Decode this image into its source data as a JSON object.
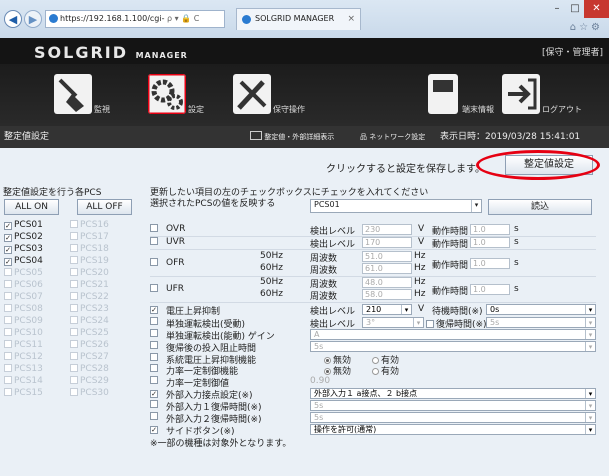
{
  "browser": {
    "url": "https://192.168.1.100/cgi-",
    "url_suffix": "ρ ▾ 🔒 C",
    "tab_title": "SOLGRID MANAGER",
    "tab_close": "×"
  },
  "header": {
    "logo": "SOLGRID",
    "logo_sub": "MANAGER",
    "right_label": "[保守・管理者]"
  },
  "icon_bar": [
    {
      "label": "監視"
    },
    {
      "label": "設定"
    },
    {
      "label": "保守操作"
    },
    {
      "label": "端末情報"
    },
    {
      "label": "ログアウト"
    }
  ],
  "subheader": {
    "title": "整定値設定",
    "link1": "整定値・外部詳細表示",
    "link2": "ネットワーク設定",
    "datetime": "表示日時：2019/03/28 15:41:01"
  },
  "main": {
    "save_hint": "クリックすると設定を保存します。",
    "save_button": "整定値設定",
    "pcs_caption": "整定値設定を行う各PCS",
    "all_on": "ALL ON",
    "all_off": "ALL OFF",
    "pcs_left": [
      {
        "label": "PCS01",
        "checked": true
      },
      {
        "label": "PCS02",
        "checked": true
      },
      {
        "label": "PCS03",
        "checked": true
      },
      {
        "label": "PCS04",
        "checked": true
      },
      {
        "label": "PCS05",
        "checked": false
      },
      {
        "label": "PCS06",
        "checked": false
      },
      {
        "label": "PCS07",
        "checked": false
      },
      {
        "label": "PCS08",
        "checked": false
      },
      {
        "label": "PCS09",
        "checked": false
      },
      {
        "label": "PCS10",
        "checked": false
      },
      {
        "label": "PCS11",
        "checked": false
      },
      {
        "label": "PCS12",
        "checked": false
      },
      {
        "label": "PCS13",
        "checked": false
      },
      {
        "label": "PCS14",
        "checked": false
      },
      {
        "label": "PCS15",
        "checked": false
      }
    ],
    "pcs_right": [
      {
        "label": "PCS16"
      },
      {
        "label": "PCS17"
      },
      {
        "label": "PCS18"
      },
      {
        "label": "PCS19"
      },
      {
        "label": "PCS20"
      },
      {
        "label": "PCS21"
      },
      {
        "label": "PCS22"
      },
      {
        "label": "PCS23"
      },
      {
        "label": "PCS24"
      },
      {
        "label": "PCS25"
      },
      {
        "label": "PCS26"
      },
      {
        "label": "PCS27"
      },
      {
        "label": "PCS28"
      },
      {
        "label": "PCS29"
      },
      {
        "label": "PCS30"
      }
    ],
    "instruction1": "更新したい項目の左のチェックボックスにチェックを入れてください",
    "instruction2": "選択されたPCSの値を反映する",
    "source_select": "PCS01",
    "read_button": "読込",
    "footnote": "※一部の機種は対象外となります。"
  },
  "settings": {
    "ovr": {
      "name": "OVR",
      "k": "検出レベル",
      "v": "230",
      "u": "V",
      "k2": "動作時間",
      "v2": "1.0",
      "u2": "s"
    },
    "uvr": {
      "name": "UVR",
      "k": "検出レベル",
      "v": "170",
      "u": "V",
      "k2": "動作時間",
      "v2": "1.0",
      "u2": "s"
    },
    "ofr": {
      "name": "OFR",
      "f1": "50Hz",
      "f2": "60Hz",
      "k": "周波数",
      "v1": "51.0",
      "v2": "61.0",
      "u": "Hz",
      "k2": "動作時間",
      "t": "1.0",
      "tu": "s"
    },
    "ufr": {
      "name": "UFR",
      "f1": "50Hz",
      "f2": "60Hz",
      "k": "周波数",
      "v1": "48.0",
      "v2": "58.0",
      "u": "Hz",
      "k2": "動作時間",
      "t": "1.0",
      "tu": "s"
    },
    "volt": {
      "name": "電圧上昇抑制",
      "k": "検出レベル",
      "v": "210",
      "u": "V",
      "k2": "待機時間(※)",
      "v2": "0s"
    },
    "passive": {
      "name": "単独運転検出(受動)",
      "k": "検出レベル",
      "v": "3°",
      "k2": "復帰時間(※)",
      "v2": "5s"
    },
    "active": {
      "name": "単独運転検出(能動) ゲイン",
      "v": "A"
    },
    "restore": {
      "name": "復帰後の投入阻止時間",
      "v": "5s"
    },
    "sys_volt": {
      "name": "系統電圧上昇抑制機能",
      "r1": "無効",
      "r2": "有効"
    },
    "pf_func": {
      "name": "力率一定制御機能",
      "r1": "無効",
      "r2": "有効"
    },
    "pf_val": {
      "name": "力率一定制御値",
      "v": "0.90"
    },
    "ext_in": {
      "name": "外部入力接点設定(※)",
      "v": "外部入力１ a接点、２ b接点"
    },
    "ext1": {
      "name": "外部入力１復帰時間(※)",
      "v": "5s"
    },
    "ext2": {
      "name": "外部入力２復帰時間(※)",
      "v": "5s"
    },
    "side": {
      "name": "サイドボタン(※)",
      "v": "操作を許可(通常)"
    }
  },
  "colors": {
    "accent": "#e60012",
    "header": "#141414",
    "panel": "#eaf0f6"
  }
}
